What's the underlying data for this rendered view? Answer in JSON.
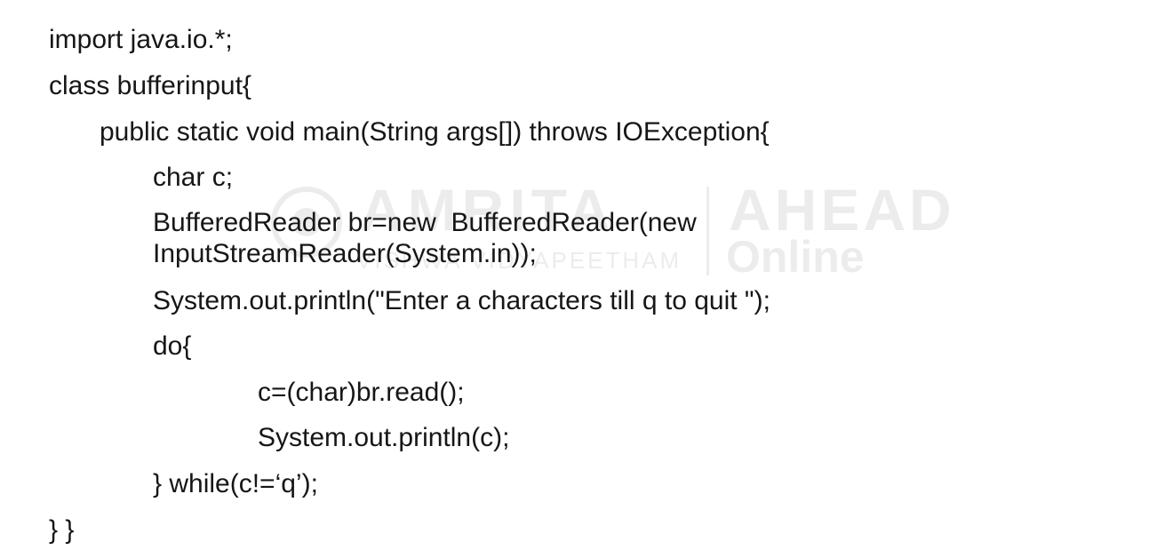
{
  "watermark": {
    "brand": "AMRITA",
    "subtitle": "VISHWA VIDYAPEETHAM",
    "partner": "AHEAD",
    "partner_sub": "Online"
  },
  "code": {
    "lines": [
      "import java.io.*;",
      "class bufferinput{",
      "public static void main(String args[]) throws IOException{",
      "char c;",
      "BufferedReader br=new  BufferedReader(new",
      "InputStreamReader(System.in));",
      "System.out.println(\"Enter a characters till q to quit \");",
      "do{",
      "c=(char)br.read();",
      "System.out.println(c);",
      "} while(c!=‘q’);",
      "} }"
    ]
  }
}
